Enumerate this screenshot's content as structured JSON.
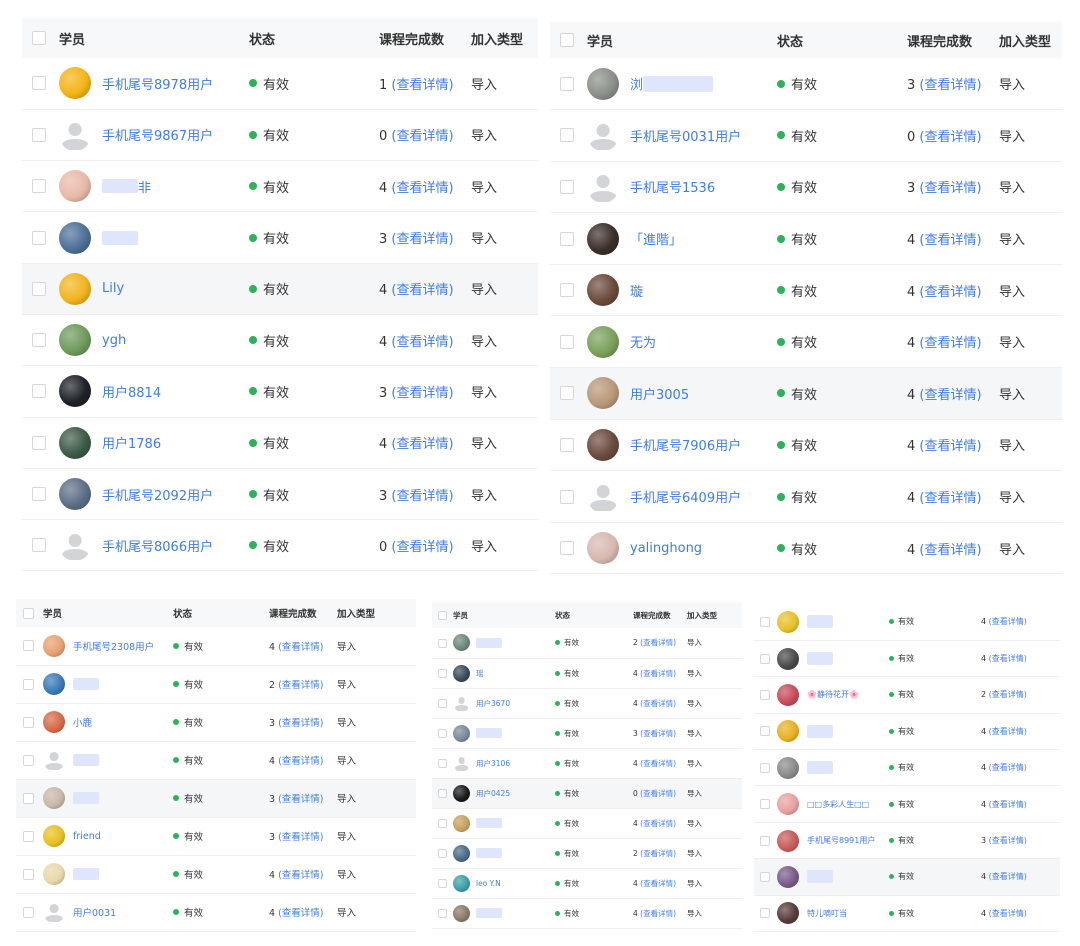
{
  "headers": {
    "student": "学员",
    "status": "状态",
    "completed": "课程完成数",
    "join_type": "加入类型"
  },
  "panels": [
    {
      "rows": [
        {
          "name": "手机尾号8978用户",
          "avatar": "#f3b414",
          "status": "有效",
          "count": "1",
          "link": "(查看详情)",
          "join": "导入"
        },
        {
          "name": "手机尾号9867用户",
          "avatar": "default",
          "status": "有效",
          "count": "0",
          "link": "(查看详情)",
          "join": "导入"
        },
        {
          "name": "非",
          "blur_before": true,
          "avatar": "#e8b9a8",
          "status": "有效",
          "count": "4",
          "link": "(查看详情)",
          "join": "导入"
        },
        {
          "name": "",
          "blur_before": true,
          "avatar": "#4d6f9a",
          "status": "有效",
          "count": "3",
          "link": "(查看详情)",
          "join": "导入"
        },
        {
          "name": "Lily",
          "avatar": "#f2b41c",
          "status": "有效",
          "count": "4",
          "link": "(查看详情)",
          "join": "导入",
          "hl": true
        },
        {
          "name": "ygh",
          "avatar": "#6e9a5c",
          "status": "有效",
          "count": "4",
          "link": "(查看详情)",
          "join": "导入"
        },
        {
          "name": "用户8814",
          "avatar": "#1e2228",
          "status": "有效",
          "count": "3",
          "link": "(查看详情)",
          "join": "导入"
        },
        {
          "name": "用户1786",
          "avatar": "#3c5a46",
          "status": "有效",
          "count": "4",
          "link": "(查看详情)",
          "join": "导入"
        },
        {
          "name": "手机尾号2092用户",
          "avatar": "#5c6e86",
          "status": "有效",
          "count": "3",
          "link": "(查看详情)",
          "join": "导入"
        },
        {
          "name": "手机尾号8066用户",
          "avatar": "default",
          "status": "有效",
          "count": "0",
          "link": "(查看详情)",
          "join": "导入"
        }
      ]
    },
    {
      "rows": [
        {
          "name": "浏",
          "blur_after": true,
          "avatar": "#8a8f88",
          "status": "有效",
          "count": "3",
          "link": "(查看详情)",
          "join": "导入"
        },
        {
          "name": "手机尾号0031用户",
          "avatar": "default",
          "status": "有效",
          "count": "0",
          "link": "(查看详情)",
          "join": "导入"
        },
        {
          "name": "手机尾号1536",
          "avatar": "default",
          "status": "有效",
          "count": "3",
          "link": "(查看详情)",
          "join": "导入"
        },
        {
          "name": "「進階」",
          "avatar": "#3a2e28",
          "status": "有效",
          "count": "4",
          "link": "(查看详情)",
          "join": "导入"
        },
        {
          "name": "璇",
          "avatar": "#6b4a3a",
          "status": "有效",
          "count": "4",
          "link": "(查看详情)",
          "join": "导入"
        },
        {
          "name": "无为",
          "avatar": "#7aa05a",
          "status": "有效",
          "count": "4",
          "link": "(查看详情)",
          "join": "导入"
        },
        {
          "name": "用户3005",
          "avatar": "#b89878",
          "status": "有效",
          "count": "4",
          "link": "(查看详情)",
          "join": "导入",
          "hl": true
        },
        {
          "name": "手机尾号7906用户",
          "avatar": "#6a4a3e",
          "status": "有效",
          "count": "4",
          "link": "(查看详情)",
          "join": "导入"
        },
        {
          "name": "手机尾号6409用户",
          "avatar": "default",
          "status": "有效",
          "count": "4",
          "link": "(查看详情)",
          "join": "导入"
        },
        {
          "name": "yalinghong",
          "avatar": "#d8b8b0",
          "status": "有效",
          "count": "4",
          "link": "(查看详情)",
          "join": "导入"
        }
      ]
    },
    {
      "rows": [
        {
          "name": "手机尾号2308用户",
          "avatar": "#e8a070",
          "status": "有效",
          "count": "4",
          "link": "(查看详情)",
          "join": "导入"
        },
        {
          "name": "",
          "blur_before": true,
          "avatar": "#3a7ab8",
          "status": "有效",
          "count": "2",
          "link": "(查看详情)",
          "join": "导入"
        },
        {
          "name": "小鹿",
          "avatar": "#d86848",
          "status": "有效",
          "count": "3",
          "link": "(查看详情)",
          "join": "导入"
        },
        {
          "name": "",
          "blur_before": true,
          "avatar": "default",
          "status": "有效",
          "count": "4",
          "link": "(查看详情)",
          "join": "导入"
        },
        {
          "name": "",
          "blur_before": true,
          "avatar": "#c8b8a8",
          "status": "有效",
          "count": "3",
          "link": "(查看详情)",
          "join": "导入",
          "hl": true
        },
        {
          "name": "friend",
          "avatar": "#e8c020",
          "status": "有效",
          "count": "3",
          "link": "(查看详情)",
          "join": "导入"
        },
        {
          "name": "",
          "blur_before": true,
          "avatar": "#e8d8a8",
          "status": "有效",
          "count": "4",
          "link": "(查看详情)",
          "join": "导入"
        },
        {
          "name": "用户0031",
          "avatar": "default",
          "status": "有效",
          "count": "4",
          "link": "(查看详情)",
          "join": "导入"
        }
      ]
    },
    {
      "rows": [
        {
          "name": "",
          "blur_after": true,
          "avatar": "#6a8a7a",
          "status": "有效",
          "count": "2",
          "link": "(查看详情)",
          "join": "导入"
        },
        {
          "name": "瑶",
          "avatar": "#3a4a5a",
          "status": "有效",
          "count": "4",
          "link": "(查看详情)",
          "join": "导入"
        },
        {
          "name": "用户3670",
          "avatar": "default",
          "status": "有效",
          "count": "4",
          "link": "(查看详情)",
          "join": "导入"
        },
        {
          "name": "",
          "blur_before": true,
          "avatar": "#7a8a98",
          "status": "有效",
          "count": "3",
          "link": "(查看详情)",
          "join": "导入"
        },
        {
          "name": "用户3106",
          "avatar": "default",
          "status": "有效",
          "count": "4",
          "link": "(查看详情)",
          "join": "导入"
        },
        {
          "name": "用户0425",
          "avatar": "#1a1a1a",
          "status": "有效",
          "count": "0",
          "link": "(查看详情)",
          "join": "导入",
          "hl": true
        },
        {
          "name": "",
          "blur_before": true,
          "avatar": "#c8a060",
          "status": "有效",
          "count": "4",
          "link": "(查看详情)",
          "join": "导入"
        },
        {
          "name": "",
          "blur_before": true,
          "avatar": "#4a6a88",
          "status": "有效",
          "count": "2",
          "link": "(查看详情)",
          "join": "导入"
        },
        {
          "name": "leo Y.N",
          "avatar": "#3aa0a8",
          "status": "有效",
          "count": "4",
          "link": "(查看详情)",
          "join": "导入"
        },
        {
          "name": "",
          "blur_before": true,
          "avatar": "#8a7a68",
          "status": "有效",
          "count": "4",
          "link": "(查看详情)",
          "join": "导入"
        }
      ]
    },
    {
      "rows": [
        {
          "name": "",
          "blur_before": true,
          "avatar": "#e8c028",
          "status": "有效",
          "count": "4",
          "link": "(查看详情)"
        },
        {
          "name": "",
          "blur_before": true,
          "avatar": "#4a4a4a",
          "status": "有效",
          "count": "4",
          "link": "(查看详情)"
        },
        {
          "name": "🌸静待花开🌸",
          "avatar": "#c84a5a",
          "status": "有效",
          "count": "2",
          "link": "(查看详情)"
        },
        {
          "name": "",
          "blur_before": true,
          "avatar": "#e8b020",
          "status": "有效",
          "count": "4",
          "link": "(查看详情)"
        },
        {
          "name": "",
          "blur_before": true,
          "avatar": "#8a8a8a",
          "status": "有效",
          "count": "4",
          "link": "(查看详情)"
        },
        {
          "name": "□□多彩人生□□",
          "avatar": "#e8a0a0",
          "status": "有效",
          "count": "4",
          "link": "(查看详情)"
        },
        {
          "name": "手机尾号8991用户",
          "avatar": "#c85a5a",
          "status": "有效",
          "count": "3",
          "link": "(查看详情)"
        },
        {
          "name": "",
          "blur_before": true,
          "avatar": "#7a5a8a",
          "status": "有效",
          "count": "4",
          "link": "(查看详情)",
          "hl": true
        },
        {
          "name": "特儿嘀叮当",
          "avatar": "#5a3a3a",
          "status": "有效",
          "count": "4",
          "link": "(查看详情)"
        }
      ]
    }
  ]
}
